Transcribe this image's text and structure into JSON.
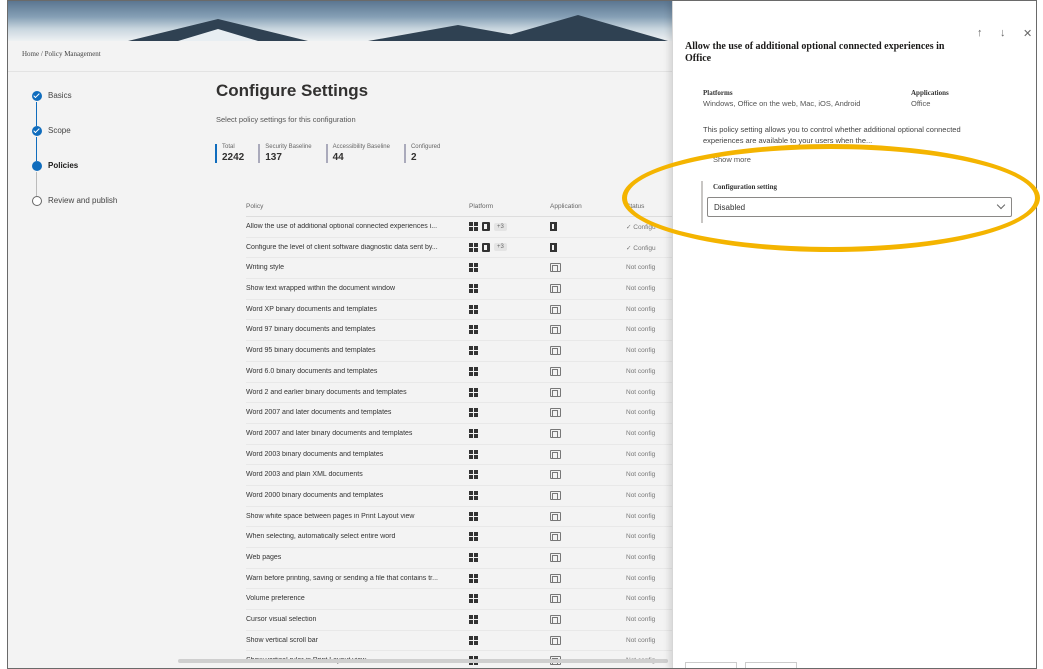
{
  "breadcrumb": {
    "home": "Home",
    "sep": "/",
    "current": "Policy Management"
  },
  "steps": [
    {
      "label": "Basics",
      "state": "done"
    },
    {
      "label": "Scope",
      "state": "done"
    },
    {
      "label": "Policies",
      "state": "active"
    },
    {
      "label": "Review and publish",
      "state": "todo"
    }
  ],
  "content": {
    "title": "Configure Settings",
    "subtitle": "Select policy settings for this configuration"
  },
  "stats": [
    {
      "label": "Total",
      "value": "2242"
    },
    {
      "label": "Security Baseline",
      "value": "137"
    },
    {
      "label": "Accessibility Baseline",
      "value": "44"
    },
    {
      "label": "Configured",
      "value": "2"
    }
  ],
  "table": {
    "headers": {
      "policy": "Policy",
      "platform": "Platform",
      "application": "Application",
      "status": "Status"
    },
    "rows": [
      {
        "policy": "Allow the use of additional optional connected experiences i...",
        "platform_more": "+3",
        "status": "✓ Configu"
      },
      {
        "policy": "Configure the level of client software diagnostic data sent by...",
        "platform_more": "+3",
        "status": "✓ Configu"
      },
      {
        "policy": "Writing style",
        "status": "Not config"
      },
      {
        "policy": "Show text wrapped within the document window",
        "status": "Not config"
      },
      {
        "policy": "Word XP binary documents and templates",
        "status": "Not config"
      },
      {
        "policy": "Word 97 binary documents and templates",
        "status": "Not config"
      },
      {
        "policy": "Word 95 binary documents and templates",
        "status": "Not config"
      },
      {
        "policy": "Word 6.0 binary documents and templates",
        "status": "Not config"
      },
      {
        "policy": "Word 2 and earlier binary documents and templates",
        "status": "Not config"
      },
      {
        "policy": "Word 2007 and later documents and templates",
        "status": "Not config"
      },
      {
        "policy": "Word 2007 and later binary documents and templates",
        "status": "Not config"
      },
      {
        "policy": "Word 2003 binary documents and templates",
        "status": "Not config"
      },
      {
        "policy": "Word 2003 and plain XML documents",
        "status": "Not config"
      },
      {
        "policy": "Word 2000 binary documents and templates",
        "status": "Not config"
      },
      {
        "policy": "Show white space between pages in Print Layout view",
        "status": "Not config"
      },
      {
        "policy": "When selecting, automatically select entire word",
        "status": "Not config"
      },
      {
        "policy": "Web pages",
        "status": "Not config"
      },
      {
        "policy": "Warn before printing, saving or sending a file that contains tr...",
        "status": "Not config"
      },
      {
        "policy": "Volume preference",
        "status": "Not config"
      },
      {
        "policy": "Cursor visual selection",
        "status": "Not config"
      },
      {
        "policy": "Show vertical scroll bar",
        "status": "Not config"
      },
      {
        "policy": "Show vertical ruler in Print Layout view",
        "status": "Not config"
      }
    ]
  },
  "panel": {
    "title": "Allow the use of additional optional connected experiences in Office",
    "nav_up": "↑",
    "nav_down": "↓",
    "close": "✕",
    "platforms_label": "Platforms",
    "platforms_value": "Windows, Office on the web, Mac, iOS, Android",
    "applications_label": "Applications",
    "applications_value": "Office",
    "description": "This policy setting allows you to control whether additional optional connected experiences are available to your users when the...",
    "show_more": "Show more",
    "config_label": "Configuration setting",
    "config_value": "Disabled"
  },
  "colors": {
    "accent": "#0f6cbd",
    "highlight": "#f4b400"
  }
}
